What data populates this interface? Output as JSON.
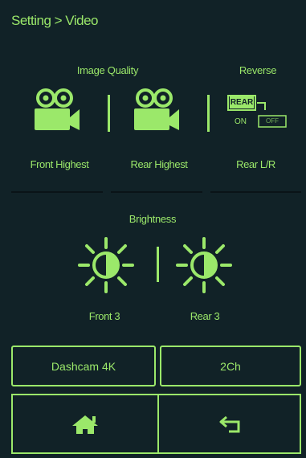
{
  "header": {
    "title": "Setting > Video"
  },
  "image_quality": {
    "title": "Image Quality",
    "front": {
      "label": "Front Highest",
      "icon": "camera-icon"
    },
    "rear": {
      "label": "Rear Highest",
      "icon": "camera-icon"
    }
  },
  "reverse": {
    "title": "Reverse",
    "label": "Rear L/R",
    "icon": "reverse-icon",
    "badge_top": "REAR",
    "badge_on": "ON",
    "badge_bottom": "OFF"
  },
  "brightness": {
    "title": "Brightness",
    "front_label": "Front 3",
    "rear_label": "Rear 3",
    "icon": "brightness-icon"
  },
  "mode_buttons": {
    "dashcam": "Dashcam 4K",
    "channels": "2Ch"
  },
  "nav": {
    "home_icon": "home-icon",
    "back_icon": "back-icon"
  },
  "colors": {
    "accent": "#9be86a",
    "background": "#112227"
  }
}
